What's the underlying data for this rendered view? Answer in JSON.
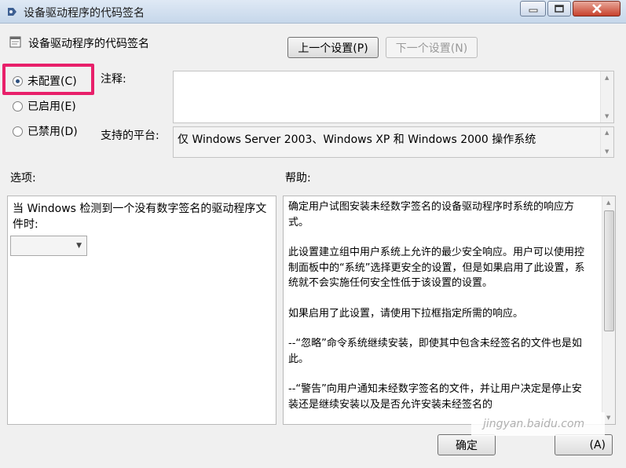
{
  "window": {
    "title": "设备驱动程序的代码签名"
  },
  "header": {
    "policy_title": "设备驱动程序的代码签名",
    "prev_label": "上一个设置(P)",
    "next_label": "下一个设置(N)"
  },
  "state": {
    "options": [
      {
        "label": "未配置(C)",
        "selected": true
      },
      {
        "label": "已启用(E)",
        "selected": false
      },
      {
        "label": "已禁用(D)",
        "selected": false
      }
    ]
  },
  "comment": {
    "label": "注释:",
    "value": ""
  },
  "platform": {
    "label": "支持的平台:",
    "value": "仅 Windows Server 2003、Windows XP 和 Windows 2000 操作系统"
  },
  "options_panel": {
    "heading": "选项:",
    "description": "当 Windows 检测到一个没有数字签名的驱动程序文件时:",
    "dropdown_value": ""
  },
  "help_panel": {
    "heading": "帮助:",
    "paragraphs": [
      "确定用户试图安装未经数字签名的设备驱动程序时系统的响应方式。",
      "此设置建立组中用户系统上允许的最少安全响应。用户可以使用控制面板中的“系统”选择更安全的设置，但是如果启用了此设置，系统就不会实施任何安全性低于该设置的设置。",
      "如果启用了此设置，请使用下拉框指定所需的响应。",
      "--“忽略”命令系统继续安装，即使其中包含未经签名的文件也是如此。",
      "--“警告”向用户通知未经数字签名的文件，并让用户决定是停止安装还是继续安装以及是否允许安装未经签名的"
    ]
  },
  "footer": {
    "ok_label": "确定",
    "apply_label": "(A)"
  },
  "watermark": "jingyan.baidu.com",
  "colors": {
    "highlight_border": "#e8206a",
    "titlebar": "#c6d7ea",
    "close_button": "#c7412c"
  }
}
